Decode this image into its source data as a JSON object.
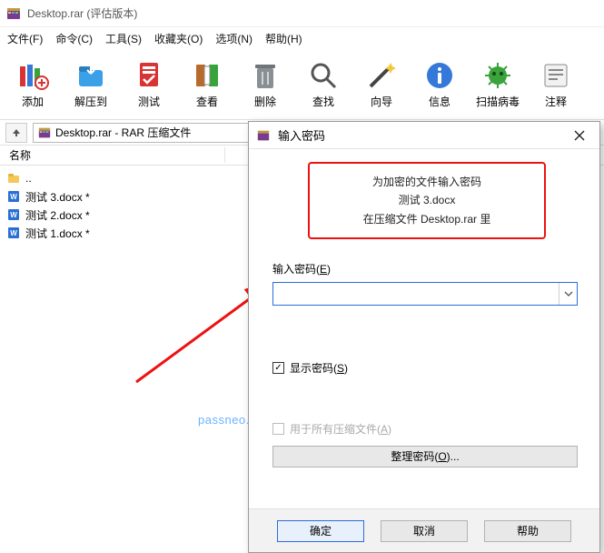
{
  "window": {
    "title": "Desktop.rar (评估版本)"
  },
  "menubar": {
    "file": "文件(F)",
    "cmd": "命令(C)",
    "tools": "工具(S)",
    "fav": "收藏夹(O)",
    "opt": "选项(N)",
    "help": "帮助(H)"
  },
  "toolbar": {
    "add": "添加",
    "extract": "解压到",
    "test": "测试",
    "view": "查看",
    "delete": "删除",
    "find": "查找",
    "wizard": "向导",
    "info": "信息",
    "scan": "扫描病毒",
    "comment": "注释"
  },
  "address": {
    "path": "Desktop.rar - RAR 压缩文件"
  },
  "columns": {
    "name": "名称"
  },
  "files": {
    "up": "..",
    "items": [
      {
        "name": "测试 3.docx *"
      },
      {
        "name": "测试 2.docx *"
      },
      {
        "name": "测试 1.docx *"
      }
    ]
  },
  "watermark": "passneo.cn",
  "dialog": {
    "title": "输入密码",
    "msg1": "为加密的文件输入密码",
    "msg2": "测试 3.docx",
    "msg3": "在压缩文件 Desktop.rar 里",
    "field_label": "输入密码(E)",
    "password_value": "",
    "show_pw": "显示密码(S)",
    "use_all": "用于所有压缩文件(A)",
    "organize": "整理密码(O)...",
    "ok": "确定",
    "cancel": "取消",
    "help": "帮助"
  }
}
